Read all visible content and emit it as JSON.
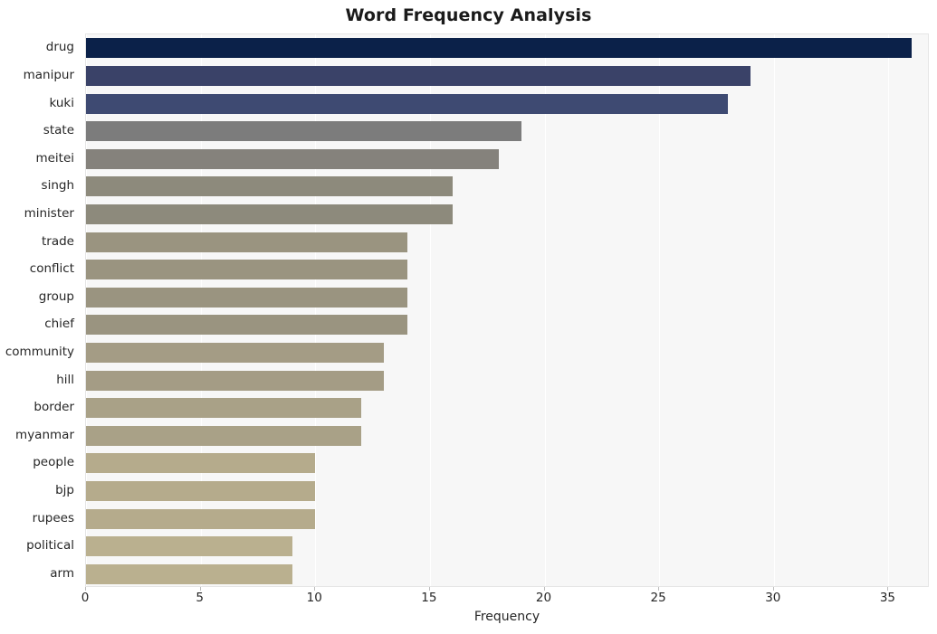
{
  "chart_data": {
    "type": "bar",
    "orientation": "horizontal",
    "title": "Word Frequency Analysis",
    "xlabel": "Frequency",
    "ylabel": "",
    "xlim": [
      0,
      36.8
    ],
    "xticks": [
      0,
      5,
      10,
      15,
      20,
      25,
      30,
      35
    ],
    "grid": true,
    "legend": null,
    "categories": [
      "drug",
      "manipur",
      "kuki",
      "state",
      "meitei",
      "singh",
      "minister",
      "trade",
      "conflict",
      "group",
      "chief",
      "community",
      "hill",
      "border",
      "myanmar",
      "people",
      "bjp",
      "rupees",
      "political",
      "arm"
    ],
    "values": [
      36,
      29,
      28,
      19,
      18,
      16,
      16,
      14,
      14,
      14,
      14,
      13,
      13,
      12,
      12,
      10,
      10,
      10,
      9,
      9
    ],
    "bar_colors": [
      "#0b2149",
      "#3a4268",
      "#3e4a72",
      "#7c7c7c",
      "#85827c",
      "#8d8a7c",
      "#8d8a7c",
      "#9a9480",
      "#9a9480",
      "#9a9480",
      "#9a9480",
      "#a49c85",
      "#a49c85",
      "#a9a187",
      "#a9a187",
      "#b5ab8c",
      "#b5ab8c",
      "#b5ab8c",
      "#bab08f",
      "#bab08f"
    ],
    "plot_bg": "#f7f7f7",
    "grid_color": "#ffffff",
    "text_color": "#262626"
  }
}
